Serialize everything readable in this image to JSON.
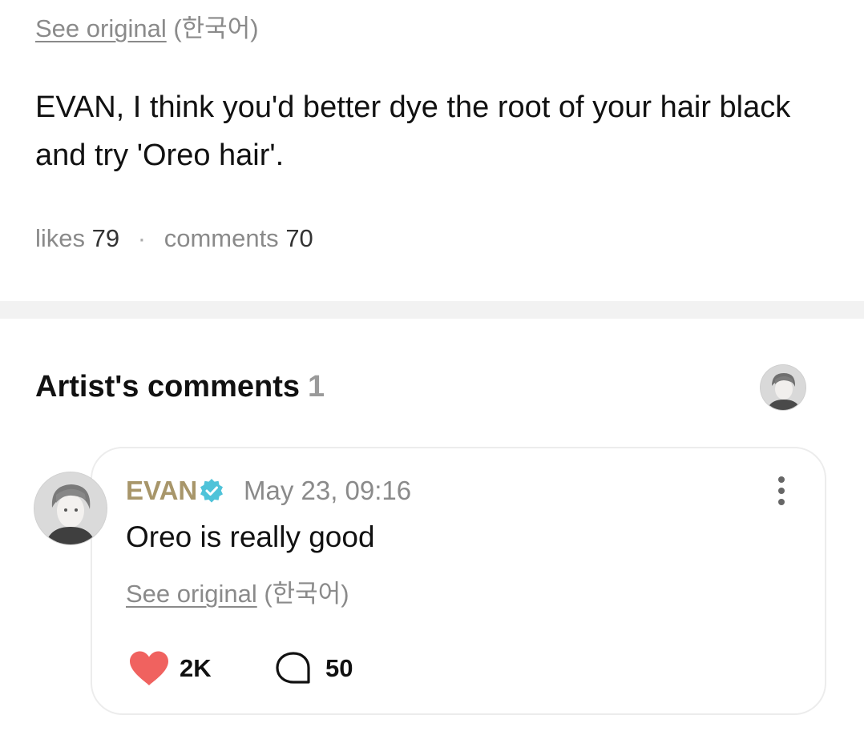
{
  "post": {
    "see_original_link": "See original",
    "see_original_lang": "(한국어)",
    "text": "EVAN, I think you'd better dye the root of your hair black and try 'Oreo hair'.",
    "likes_label": "likes",
    "likes_count": "79",
    "separator": "·",
    "comments_label": "comments",
    "comments_count": "70"
  },
  "artist_comments": {
    "title": "Artist's comments",
    "count": "1",
    "comment": {
      "author": "EVAN",
      "timestamp": "May 23, 09:16",
      "text": "Oreo is really good",
      "see_original_link": "See original",
      "see_original_lang": "(한국어)",
      "likes": "2K",
      "replies": "50"
    }
  },
  "colors": {
    "author_name": "#a8966a",
    "verified_badge": "#4fc3d9",
    "heart": "#f0625f",
    "muted_text": "#8a8a8a",
    "divider": "#f2f2f2"
  },
  "icons": [
    "verified-badge-icon",
    "more-options-icon",
    "heart-icon",
    "comment-bubble-icon"
  ]
}
